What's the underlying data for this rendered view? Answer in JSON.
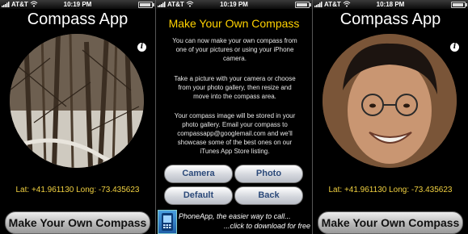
{
  "status_bars": [
    {
      "carrier": "AT&T",
      "time": "10:19 PM",
      "battery_level": 0.8
    },
    {
      "carrier": "AT&T",
      "time": "10:19 PM",
      "battery_level": 0.8
    },
    {
      "carrier": "AT&T",
      "time": "10:18 PM",
      "battery_level": 0.8
    }
  ],
  "screen_left": {
    "title": "Compass App",
    "info_glyph": "i",
    "photo": "forest-trees",
    "coords": "Lat: +41.961130  Long: -73.435623",
    "button_label": "Make Your Own Compass"
  },
  "screen_middle": {
    "title": "Make Your Own Compass",
    "paragraphs": [
      "You can now make your own compass from one of your pictures or using your iPhone camera.",
      "Take a picture with your camera or choose from your photo gallery, then resize and move into the compass area.",
      "Your compass image will be stored in your photo gallery. Email your compass to compassapp@googlemail.com and we'll showcase some of the best ones on our iTunes App Store listing."
    ],
    "buttons": {
      "camera": "Camera",
      "photo": "Photo",
      "default": "Default",
      "back": "Back"
    },
    "ad": {
      "line1": "PhoneApp, the easier way to call...",
      "line2": "...click to download for free"
    }
  },
  "screen_right": {
    "title": "Compass App",
    "info_glyph": "i",
    "photo": "smiling-man-face",
    "coords": "Lat: +41.961130  Long: -73.435623",
    "button_label": "Make Your Own Compass"
  },
  "colors": {
    "accent_yellow": "#f0d040",
    "title_yellow": "#ffd200",
    "button_text_blue": "#2c4a7a"
  }
}
